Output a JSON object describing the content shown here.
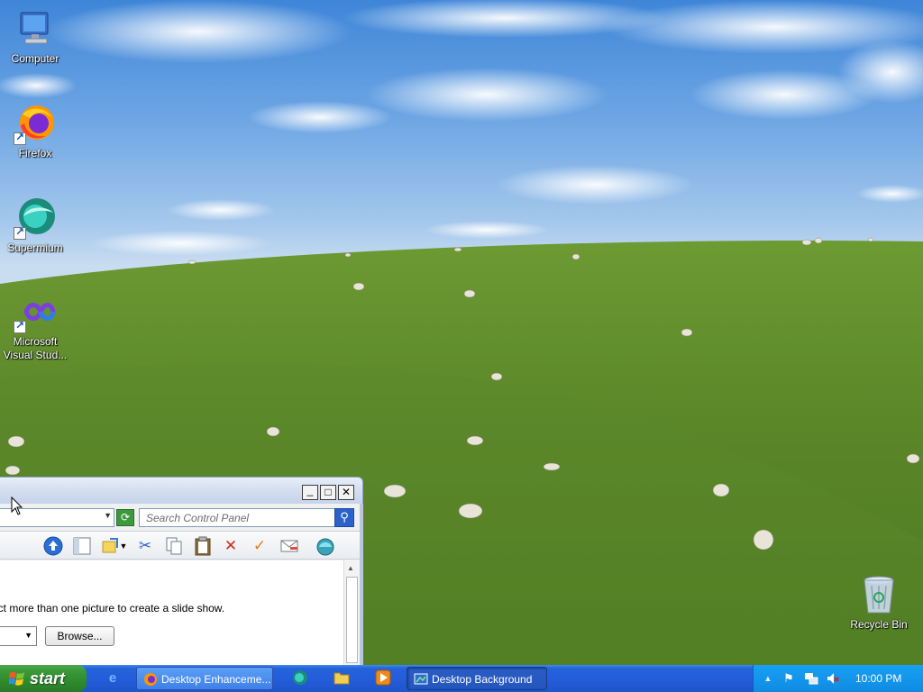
{
  "desktop": {
    "icons": [
      {
        "label": "Computer",
        "icon": "computer-icon"
      },
      {
        "label": "Firefox",
        "icon": "firefox-icon",
        "shortcut": true
      },
      {
        "label": "Supermium",
        "icon": "supermium-icon",
        "shortcut": true
      },
      {
        "label": "Microsoft Visual Stud...",
        "icon": "visual-studio-icon",
        "shortcut": true
      },
      {
        "label": "Recycle Bin",
        "icon": "recycle-bin-icon"
      }
    ]
  },
  "window": {
    "controls": {
      "minimize": "_",
      "maximize": "□",
      "close": "✕"
    },
    "search_placeholder": "Search Control Panel",
    "toolbar_icons": [
      "up-icon",
      "folders-icon",
      "views-icon",
      "cut-icon",
      "copy-icon",
      "paste-icon",
      "delete-icon",
      "undo-check-icon",
      "email-icon",
      "shell-icon"
    ],
    "hint_text": "ect more than one picture to create a slide show.",
    "browse_label": "Browse..."
  },
  "taskbar": {
    "start_label": "start",
    "tasks": [
      {
        "label": "Desktop Enhanceme...",
        "icon": "firefox-icon",
        "active": false
      },
      {
        "label": "Desktop Background",
        "icon": "control-panel-icon",
        "active": true
      }
    ],
    "quick_launch": [
      "internet-explorer-icon",
      "supermium-icon",
      "folder-icon",
      "media-player-icon"
    ],
    "tray_icons": [
      "show-hidden-icons-icon",
      "flag-icon",
      "network-icon",
      "volume-muted-icon"
    ],
    "clock": "10:00 PM"
  },
  "colors": {
    "taskbar": "#245ddb",
    "start": "#3c9a3a",
    "tray": "#0f8be3",
    "grass": "#5e8a2a"
  }
}
